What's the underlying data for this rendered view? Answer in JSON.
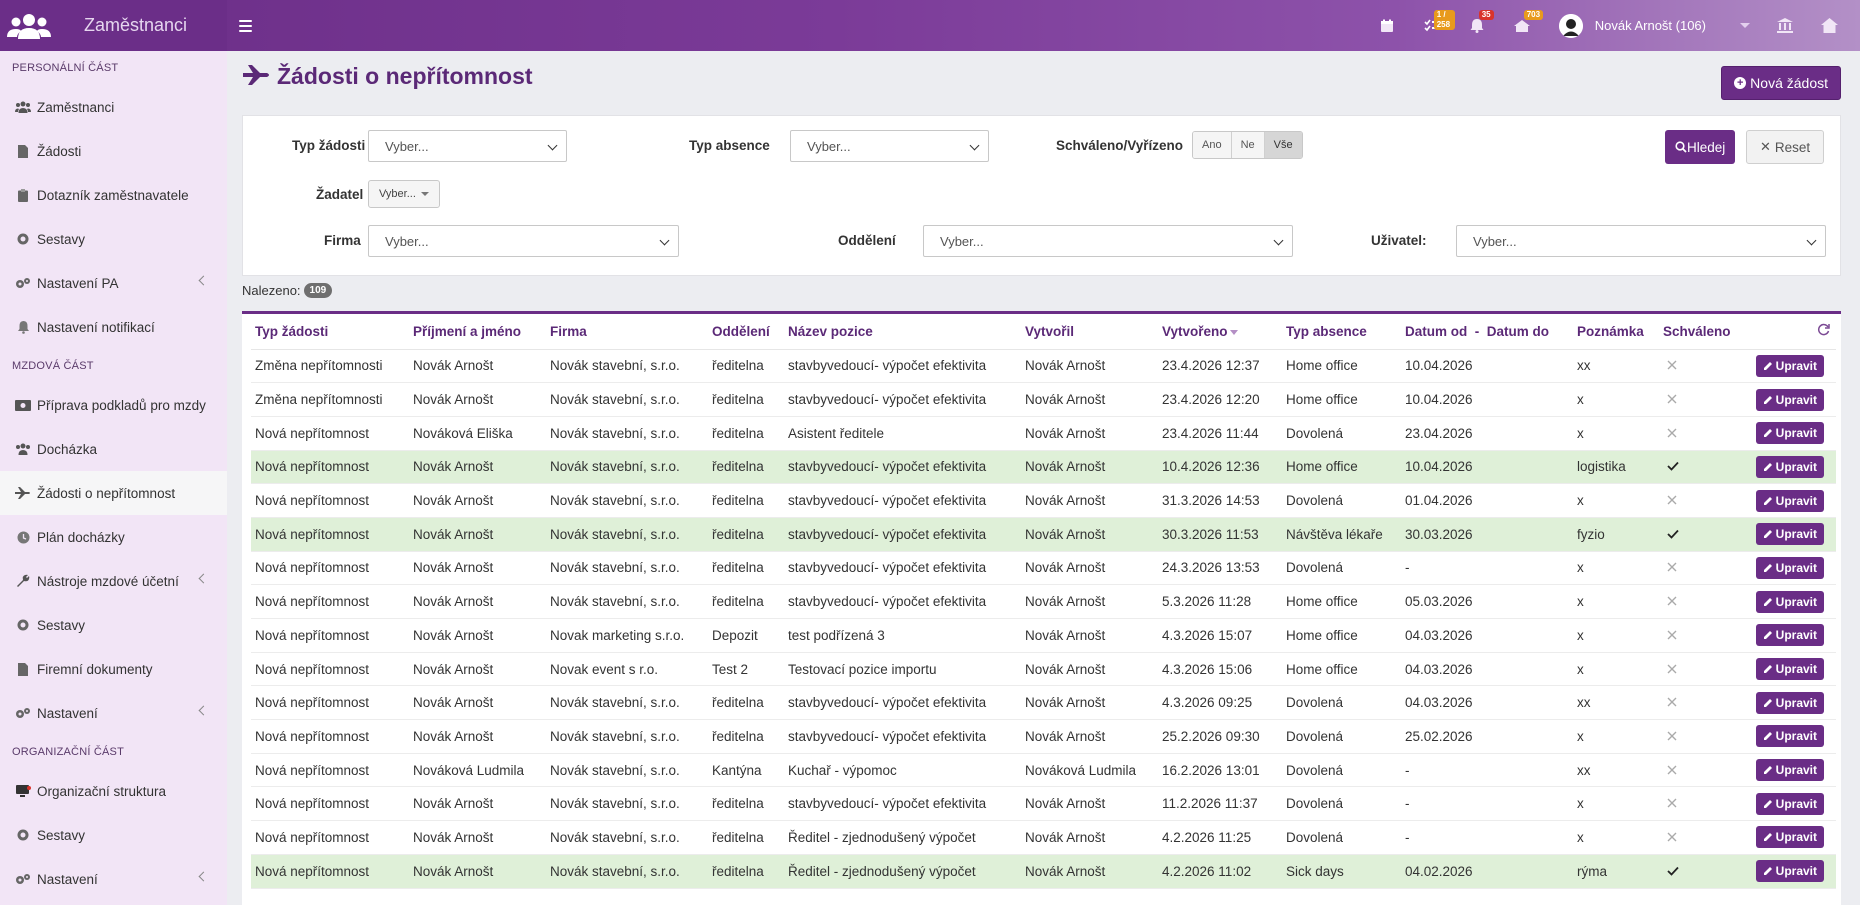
{
  "app": {
    "title": "Zaměstnanci"
  },
  "header": {
    "badges": {
      "tasks": "1 / 258",
      "notifications": "35",
      "messages": "703"
    },
    "user": "Novák Arnošt (106)"
  },
  "sidebar": {
    "sections": {
      "personal": "PERSONÁLNÍ ČÁST",
      "payroll": "MZDOVÁ ČÁST",
      "org": "ORGANIZAČNÍ ČÁST"
    },
    "personal_items": [
      "Zaměstnanci",
      "Žádosti",
      "Dotazník zaměstnavatele",
      "Sestavy",
      "Nastavení PA",
      "Nastavení notifikací"
    ],
    "payroll_items": [
      "Příprava podkladů pro mzdy",
      "Docházka",
      "Žádosti o nepřítomnost",
      "Plán docházky",
      "Nástroje mzdové účetní",
      "Sestavy",
      "Firemní dokumenty",
      "Nastavení"
    ],
    "org_items": [
      "Organizační struktura",
      "Sestavy",
      "Nastavení"
    ]
  },
  "page": {
    "title": "Žádosti o nepřítomnost",
    "new_button": "Nová žádost"
  },
  "filters": {
    "request_type_label": "Typ žádosti",
    "request_type_value": "Vyber...",
    "absence_type_label": "Typ absence",
    "absence_type_value": "Vyber...",
    "approved_label": "Schváleno/Vyřízeno",
    "approved_options": [
      "Ano",
      "Ne",
      "Vše"
    ],
    "applicant_label": "Žadatel",
    "applicant_value": "Vyber...",
    "company_label": "Firma",
    "company_value": "Vyber...",
    "department_label": "Oddělení",
    "department_value": "Vyber...",
    "user_label": "Uživatel:",
    "user_value": "Vyber...",
    "search_button": "Hledej",
    "reset_button": "Reset"
  },
  "results": {
    "label": "Nalezeno:",
    "count": "109"
  },
  "table": {
    "columns": [
      "Typ žádosti",
      "Příjmení a jméno",
      "Firma",
      "Oddělení",
      "Název pozice",
      "Vytvořil",
      "Vytvořeno",
      "Typ absence",
      "Datum od",
      "-",
      "Datum do",
      "Poznámka",
      "Schváleno"
    ],
    "edit_label": "Upravit",
    "rows": [
      {
        "type": "Změna nepřítomnosti",
        "name": "Novák Arnošt",
        "company": "Novák stavební, s.r.o.",
        "dept": "ředitelna",
        "position": "stavbyvedoucí- výpočet efektivita",
        "creator": "Novák Arnošt",
        "created": "23.4.2026 12:37",
        "absence": "Home office",
        "from": "10.04.2026",
        "note": "xx",
        "approved": false
      },
      {
        "type": "Změna nepřítomnosti",
        "name": "Novák Arnošt",
        "company": "Novák stavební, s.r.o.",
        "dept": "ředitelna",
        "position": "stavbyvedoucí- výpočet efektivita",
        "creator": "Novák Arnošt",
        "created": "23.4.2026 12:20",
        "absence": "Home office",
        "from": "10.04.2026",
        "note": "x",
        "approved": false
      },
      {
        "type": "Nová nepřítomnost",
        "name": "Nováková Eliška",
        "company": "Novák stavební, s.r.o.",
        "dept": "ředitelna",
        "position": "Asistent ředitele",
        "creator": "Novák Arnošt",
        "created": "23.4.2026 11:44",
        "absence": "Dovolená",
        "from": "23.04.2026",
        "note": "x",
        "approved": false
      },
      {
        "type": "Nová nepřítomnost",
        "name": "Novák Arnošt",
        "company": "Novák stavební, s.r.o.",
        "dept": "ředitelna",
        "position": "stavbyvedoucí- výpočet efektivita",
        "creator": "Novák Arnošt",
        "created": "10.4.2026 12:36",
        "absence": "Home office",
        "from": "10.04.2026",
        "note": "logistika",
        "approved": true
      },
      {
        "type": "Nová nepřítomnost",
        "name": "Novák Arnošt",
        "company": "Novák stavební, s.r.o.",
        "dept": "ředitelna",
        "position": "stavbyvedoucí- výpočet efektivita",
        "creator": "Novák Arnošt",
        "created": "31.3.2026 14:53",
        "absence": "Dovolená",
        "from": "01.04.2026",
        "note": "x",
        "approved": false
      },
      {
        "type": "Nová nepřítomnost",
        "name": "Novák Arnošt",
        "company": "Novák stavební, s.r.o.",
        "dept": "ředitelna",
        "position": "stavbyvedoucí- výpočet efektivita",
        "creator": "Novák Arnošt",
        "created": "30.3.2026 11:53",
        "absence": "Návštěva lékaře",
        "from": "30.03.2026",
        "note": "fyzio",
        "approved": true
      },
      {
        "type": "Nová nepřítomnost",
        "name": "Novák Arnošt",
        "company": "Novák stavební, s.r.o.",
        "dept": "ředitelna",
        "position": "stavbyvedoucí- výpočet efektivita",
        "creator": "Novák Arnošt",
        "created": "24.3.2026 13:53",
        "absence": "Dovolená",
        "from": "-",
        "note": "x",
        "approved": false
      },
      {
        "type": "Nová nepřítomnost",
        "name": "Novák Arnošt",
        "company": "Novák stavební, s.r.o.",
        "dept": "ředitelna",
        "position": "stavbyvedoucí- výpočet efektivita",
        "creator": "Novák Arnošt",
        "created": "5.3.2026 11:28",
        "absence": "Home office",
        "from": "05.03.2026",
        "note": "x",
        "approved": false
      },
      {
        "type": "Nová nepřítomnost",
        "name": "Novák Arnošt",
        "company": "Novak marketing s.r.o.",
        "dept": "Depozit",
        "position": "test podřízená 3",
        "creator": "Novák Arnošt",
        "created": "4.3.2026 15:07",
        "absence": "Home office",
        "from": "04.03.2026",
        "note": "x",
        "approved": false
      },
      {
        "type": "Nová nepřítomnost",
        "name": "Novák Arnošt",
        "company": "Novak event s r.o.",
        "dept": "Test 2",
        "position": "Testovací pozice importu",
        "creator": "Novák Arnošt",
        "created": "4.3.2026 15:06",
        "absence": "Home office",
        "from": "04.03.2026",
        "note": "x",
        "approved": false
      },
      {
        "type": "Nová nepřítomnost",
        "name": "Novák Arnošt",
        "company": "Novák stavební, s.r.o.",
        "dept": "ředitelna",
        "position": "stavbyvedoucí- výpočet efektivita",
        "creator": "Novák Arnošt",
        "created": "4.3.2026 09:25",
        "absence": "Dovolená",
        "from": "04.03.2026",
        "note": "xx",
        "approved": false
      },
      {
        "type": "Nová nepřítomnost",
        "name": "Novák Arnošt",
        "company": "Novák stavební, s.r.o.",
        "dept": "ředitelna",
        "position": "stavbyvedoucí- výpočet efektivita",
        "creator": "Novák Arnošt",
        "created": "25.2.2026 09:30",
        "absence": "Dovolená",
        "from": "25.02.2026",
        "note": "x",
        "approved": false
      },
      {
        "type": "Nová nepřítomnost",
        "name": "Nováková Ludmila",
        "company": "Novák stavební, s.r.o.",
        "dept": "Kantýna",
        "position": "Kuchař - výpomoc",
        "creator": "Nováková Ludmila",
        "created": "16.2.2026 13:01",
        "absence": "Dovolená",
        "from": "-",
        "note": "xx",
        "approved": false
      },
      {
        "type": "Nová nepřítomnost",
        "name": "Novák Arnošt",
        "company": "Novák stavební, s.r.o.",
        "dept": "ředitelna",
        "position": "stavbyvedoucí- výpočet efektivita",
        "creator": "Novák Arnošt",
        "created": "11.2.2026 11:37",
        "absence": "Dovolená",
        "from": "-",
        "note": "x",
        "approved": false
      },
      {
        "type": "Nová nepřítomnost",
        "name": "Novák Arnošt",
        "company": "Novák stavební, s.r.o.",
        "dept": "ředitelna",
        "position": "Ředitel - zjednodušený výpočet",
        "creator": "Novák Arnošt",
        "created": "4.2.2026 11:25",
        "absence": "Dovolená",
        "from": "-",
        "note": "x",
        "approved": false
      },
      {
        "type": "Nová nepřítomnost",
        "name": "Novák Arnošt",
        "company": "Novák stavební, s.r.o.",
        "dept": "ředitelna",
        "position": "Ředitel - zjednodušený výpočet",
        "creator": "Novák Arnošt",
        "created": "4.2.2026 11:02",
        "absence": "Sick days",
        "from": "04.02.2026",
        "note": "rýma",
        "approved": true
      }
    ]
  },
  "colors": {
    "brand": "#6a2d86",
    "approved_row": "#dff0d8",
    "sidebar_bg": "#f2e5f6"
  }
}
